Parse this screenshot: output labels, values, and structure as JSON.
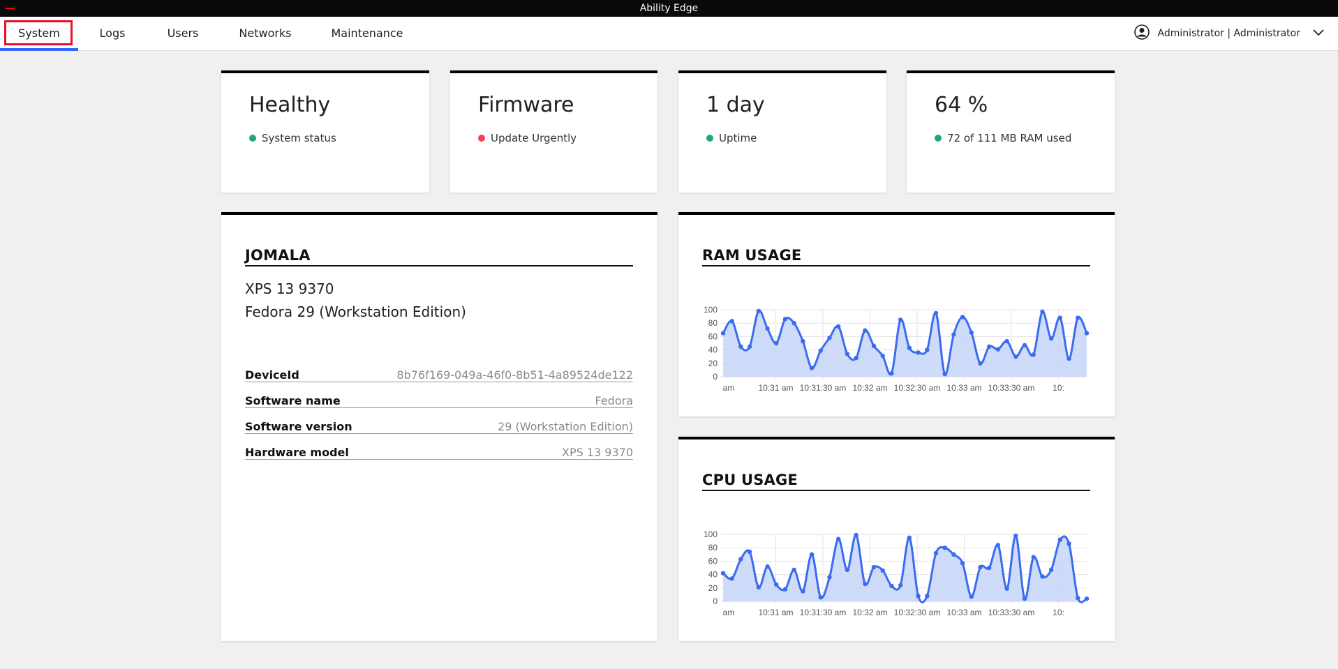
{
  "window": {
    "title": "Ability Edge"
  },
  "nav": {
    "tabs": [
      {
        "label": "System"
      },
      {
        "label": "Logs"
      },
      {
        "label": "Users"
      },
      {
        "label": "Networks"
      },
      {
        "label": "Maintenance"
      }
    ],
    "active_tab": "System",
    "user_label": "Administrator | Administrator"
  },
  "stats": [
    {
      "value": "Healthy",
      "label": "System status",
      "status_color": "#21a67a"
    },
    {
      "value": "Firmware",
      "label": "Update Urgently",
      "status_color": "#ff3b55"
    },
    {
      "value": "1 day",
      "label": "Uptime",
      "status_color": "#21a67a"
    },
    {
      "value": "64 %",
      "label": "72 of 111 MB RAM used",
      "status_color": "#21a67a"
    }
  ],
  "device": {
    "name": "JOMALA",
    "model_line": "XPS 13 9370",
    "os_line": "Fedora 29 (Workstation Edition)",
    "fields": [
      {
        "key": "DeviceId",
        "value": "8b76f169-049a-46f0-8b51-4a89524de122"
      },
      {
        "key": "Software name",
        "value": "Fedora"
      },
      {
        "key": "Software version",
        "value": "29 (Workstation Edition)"
      },
      {
        "key": "Hardware model",
        "value": "XPS 13 9370"
      }
    ]
  },
  "colors": {
    "accent": "#3366ff",
    "highlight": "#e8112d",
    "series_line": "#3b6cf0",
    "series_fill": "#c7d6f8"
  },
  "chart_data": [
    {
      "type": "area",
      "title": "RAM USAGE",
      "ylim": [
        0,
        100
      ],
      "yticks": [
        0,
        20,
        40,
        60,
        80,
        100
      ],
      "xtick_labels": [
        "am",
        "10:31 am",
        "10:31:30 am",
        "10:32 am",
        "10:32:30 am",
        "10:33 am",
        "10:33:30 am",
        "10:"
      ],
      "series": [
        {
          "values": [
            65,
            83,
            45,
            45,
            98,
            72,
            50,
            86,
            80,
            53,
            13,
            39,
            58,
            75,
            34,
            28,
            69,
            46,
            31,
            5,
            85,
            43,
            36,
            40,
            95,
            4,
            63,
            89,
            66,
            20,
            45,
            41,
            53,
            30,
            47,
            33,
            97,
            57,
            88,
            27,
            88,
            65
          ]
        }
      ]
    },
    {
      "type": "area",
      "title": "CPU USAGE",
      "ylim": [
        0,
        100
      ],
      "yticks": [
        0,
        20,
        40,
        60,
        80,
        100
      ],
      "xtick_labels": [
        "am",
        "10:31 am",
        "10:31:30 am",
        "10:32 am",
        "10:32:30 am",
        "10:33 am",
        "10:33:30 am",
        "10:"
      ],
      "series": [
        {
          "values": [
            42,
            34,
            63,
            74,
            21,
            52,
            25,
            18,
            47,
            15,
            70,
            6,
            36,
            93,
            47,
            99,
            26,
            51,
            46,
            23,
            24,
            95,
            8,
            8,
            72,
            80,
            70,
            57,
            7,
            51,
            50,
            84,
            19,
            98,
            4,
            66,
            37,
            47,
            92,
            86,
            5,
            4
          ]
        }
      ]
    }
  ]
}
